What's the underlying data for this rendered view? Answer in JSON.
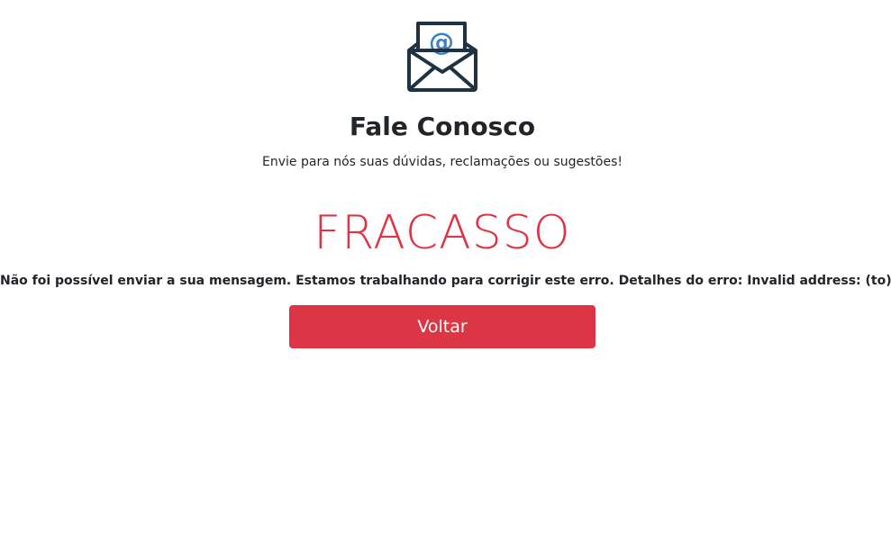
{
  "header": {
    "icon": "envelope-at-icon",
    "title": "Fale Conosco",
    "subtitle": "Envie para nós suas dúvidas, reclamações ou sugestões!"
  },
  "result": {
    "status": "FRACASSO",
    "message": "Não foi possível enviar a sua mensagem. Estamos trabalhando para corrigir este erro. Detalhes do erro: Invalid address: (to):"
  },
  "actions": {
    "back_label": "Voltar"
  },
  "colors": {
    "danger": "#dc3545",
    "icon_dark": "#1e3242",
    "icon_accent": "#3b82c4",
    "text": "#212529"
  }
}
